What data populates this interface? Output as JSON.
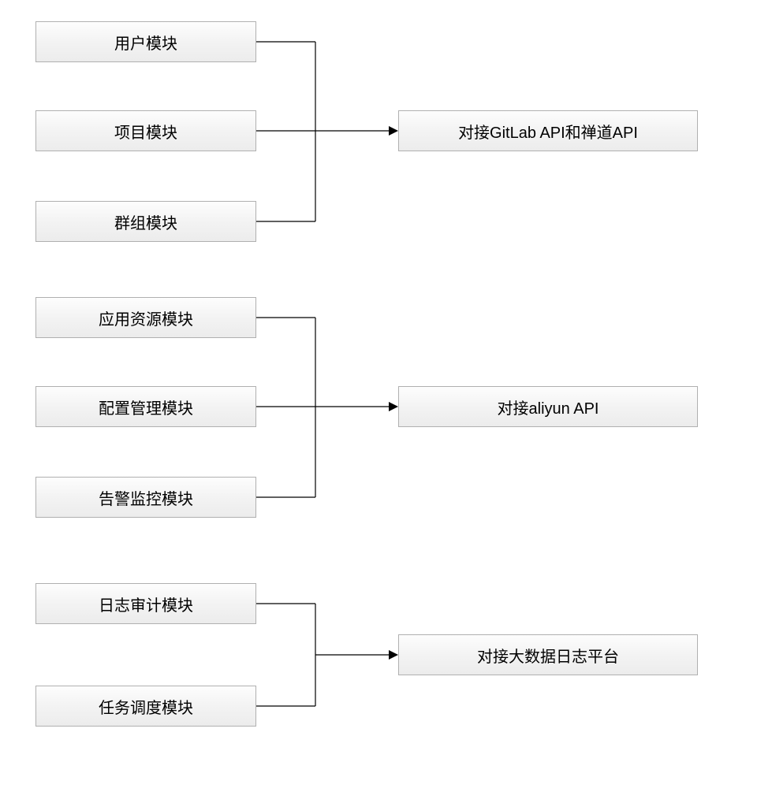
{
  "groups": [
    {
      "left": [
        {
          "id": "user_module",
          "label": "用户模块"
        },
        {
          "id": "project_module",
          "label": "项目模块"
        },
        {
          "id": "group_module",
          "label": "群组模块"
        }
      ],
      "right": {
        "id": "gitlab_zendao_api",
        "label": "对接GitLab API和禅道API"
      }
    },
    {
      "left": [
        {
          "id": "app_resource_module",
          "label": "应用资源模块"
        },
        {
          "id": "config_management_module",
          "label": "配置管理模块"
        },
        {
          "id": "alarm_monitor_module",
          "label": "告警监控模块"
        }
      ],
      "right": {
        "id": "aliyun_api",
        "label": "对接aliyun API"
      }
    },
    {
      "left": [
        {
          "id": "log_audit_module",
          "label": "日志审计模块"
        },
        {
          "id": "task_schedule_module",
          "label": "任务调度模块"
        }
      ],
      "right": {
        "id": "bigdata_log_platform",
        "label": "对接大数据日志平台"
      }
    }
  ]
}
